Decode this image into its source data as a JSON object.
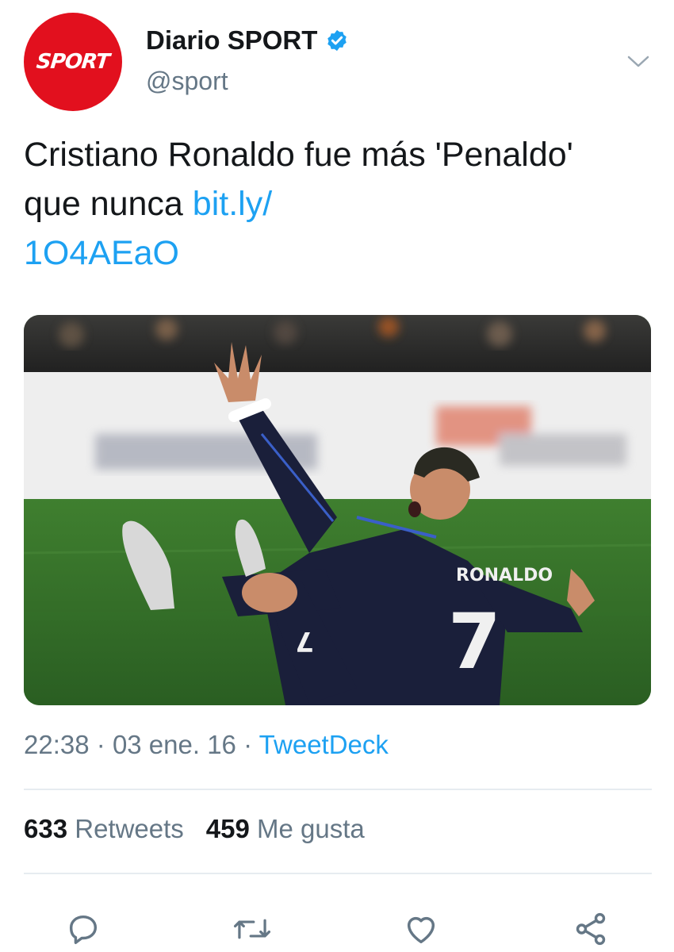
{
  "header": {
    "avatar_text": "SPORT",
    "display_name": "Diario SPORT",
    "handle": "@sport",
    "verified_icon": "verified-badge-icon",
    "more_icon": "chevron-down-icon"
  },
  "tweet": {
    "text": "Cristiano Ronaldo fue más 'Penaldo' que nunca ",
    "link": "bit.ly/\n1O4AEaO",
    "image": {
      "jersey_name": "RONALDO",
      "jersey_number": "7",
      "shorts_number": "7"
    }
  },
  "meta": {
    "time": "22:38",
    "sep1": "·",
    "date": "03 ene. 16",
    "sep2": "·",
    "source": "TweetDeck"
  },
  "stats": {
    "retweets_count": "633",
    "retweets_label": "Retweets",
    "likes_count": "459",
    "likes_label": "Me gusta"
  },
  "actions": [
    "reply-icon",
    "retweet-icon",
    "like-icon",
    "share-icon"
  ],
  "colors": {
    "brand_red": "#e2101e",
    "link_blue": "#1da1f2",
    "muted": "#657786",
    "text": "#14171a",
    "divider": "#e6ecf0"
  }
}
